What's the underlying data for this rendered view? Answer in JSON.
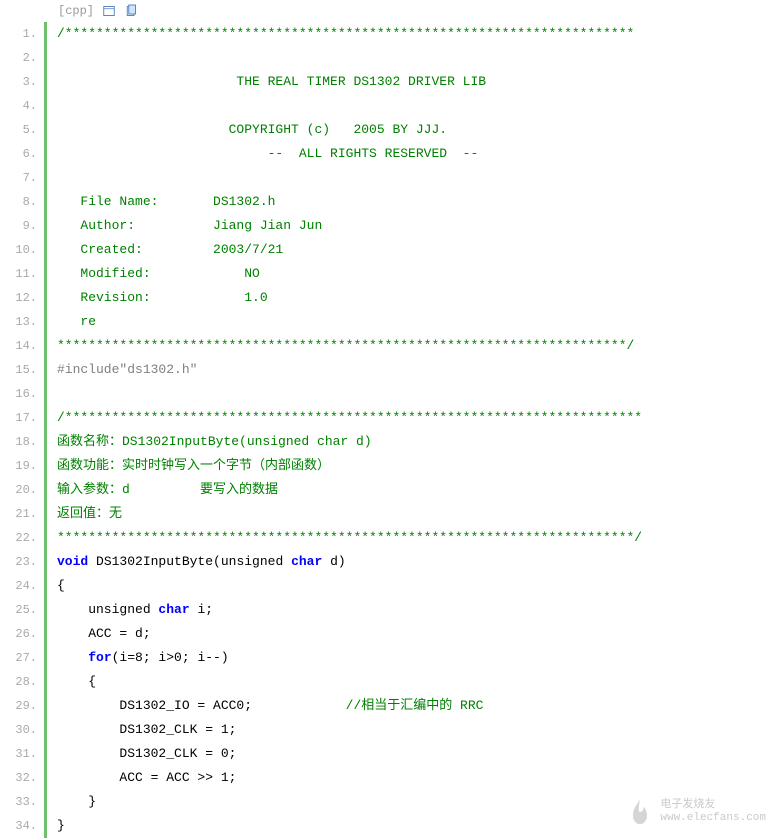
{
  "header": {
    "lang_tag": "[cpp]"
  },
  "lines": [
    {
      "n": "1.",
      "cls": "comment",
      "text": "/*************************************************************************"
    },
    {
      "n": "2.",
      "cls": "comment",
      "text": ""
    },
    {
      "n": "3.",
      "cls": "comment",
      "text": "                       THE REAL TIMER DS1302 DRIVER LIB"
    },
    {
      "n": "4.",
      "cls": "comment",
      "text": ""
    },
    {
      "n": "5.",
      "cls": "comment",
      "text": "                      COPYRIGHT (c)   2005 BY JJJ."
    },
    {
      "n": "6.",
      "cls": "comment",
      "text": "                           --  ALL RIGHTS RESERVED  --"
    },
    {
      "n": "7.",
      "cls": "comment",
      "text": ""
    },
    {
      "n": "8.",
      "cls": "comment",
      "text": "   File Name:       DS1302.h"
    },
    {
      "n": "9.",
      "cls": "comment",
      "text": "   Author:          Jiang Jian Jun"
    },
    {
      "n": "10.",
      "cls": "comment",
      "text": "   Created:         2003/7/21"
    },
    {
      "n": "11.",
      "cls": "comment",
      "text": "   Modified:\t\tNO"
    },
    {
      "n": "12.",
      "cls": "comment",
      "text": "   Revision:\t\t1.0"
    },
    {
      "n": "13.",
      "cls": "comment",
      "text": "   re"
    },
    {
      "n": "14.",
      "cls": "comment",
      "text": "*************************************************************************/"
    },
    {
      "n": "15.",
      "cls": "preproc",
      "text": "#include\"ds1302.h\""
    },
    {
      "n": "16.",
      "cls": "normal",
      "text": ""
    },
    {
      "n": "17.",
      "cls": "comment",
      "text": "/**************************************************************************"
    },
    {
      "n": "18.",
      "cls": "comment",
      "text": "函数名称：DS1302InputByte(unsigned char d)"
    },
    {
      "n": "19.",
      "cls": "comment",
      "text": "函数功能：实时时钟写入一个字节（内部函数）"
    },
    {
      "n": "20.",
      "cls": "comment",
      "text": "输入参数：d         要写入的数据"
    },
    {
      "n": "21.",
      "cls": "comment",
      "text": "返回值：无"
    },
    {
      "n": "22.",
      "cls": "comment",
      "text": "**************************************************************************/"
    },
    {
      "n": "23.",
      "cls": "code23",
      "text": ""
    },
    {
      "n": "24.",
      "cls": "normal",
      "text": "{  "
    },
    {
      "n": "25.",
      "cls": "code25",
      "text": ""
    },
    {
      "n": "26.",
      "cls": "normal",
      "text": "    ACC = d;  "
    },
    {
      "n": "27.",
      "cls": "code27",
      "text": ""
    },
    {
      "n": "28.",
      "cls": "normal",
      "text": "    {  "
    },
    {
      "n": "29.",
      "cls": "code29",
      "text": ""
    },
    {
      "n": "30.",
      "cls": "normal",
      "text": "        DS1302_CLK = 1;  "
    },
    {
      "n": "31.",
      "cls": "normal",
      "text": "        DS1302_CLK = 0;  "
    },
    {
      "n": "32.",
      "cls": "normal",
      "text": "        ACC = ACC >> 1;  "
    },
    {
      "n": "33.",
      "cls": "normal",
      "text": "    }  "
    },
    {
      "n": "34.",
      "cls": "normal",
      "text": "}  "
    }
  ],
  "code23": {
    "kw1": "void",
    "txt1": " DS1302InputByte(unsigned ",
    "kw2": "char",
    "txt2": " d)  "
  },
  "code25": {
    "txt1": "    unsigned ",
    "kw1": "char",
    "txt2": " i;  "
  },
  "code27": {
    "txt1": "    ",
    "kw1": "for",
    "txt2": "(i=8; i>0; i--)  "
  },
  "code29": {
    "txt1": "        DS1302_IO = ACC0;            ",
    "cmt": "//相当于汇编中的 RRC  "
  },
  "watermark": {
    "title": "电子发烧友",
    "url": "www.elecfans.com"
  }
}
